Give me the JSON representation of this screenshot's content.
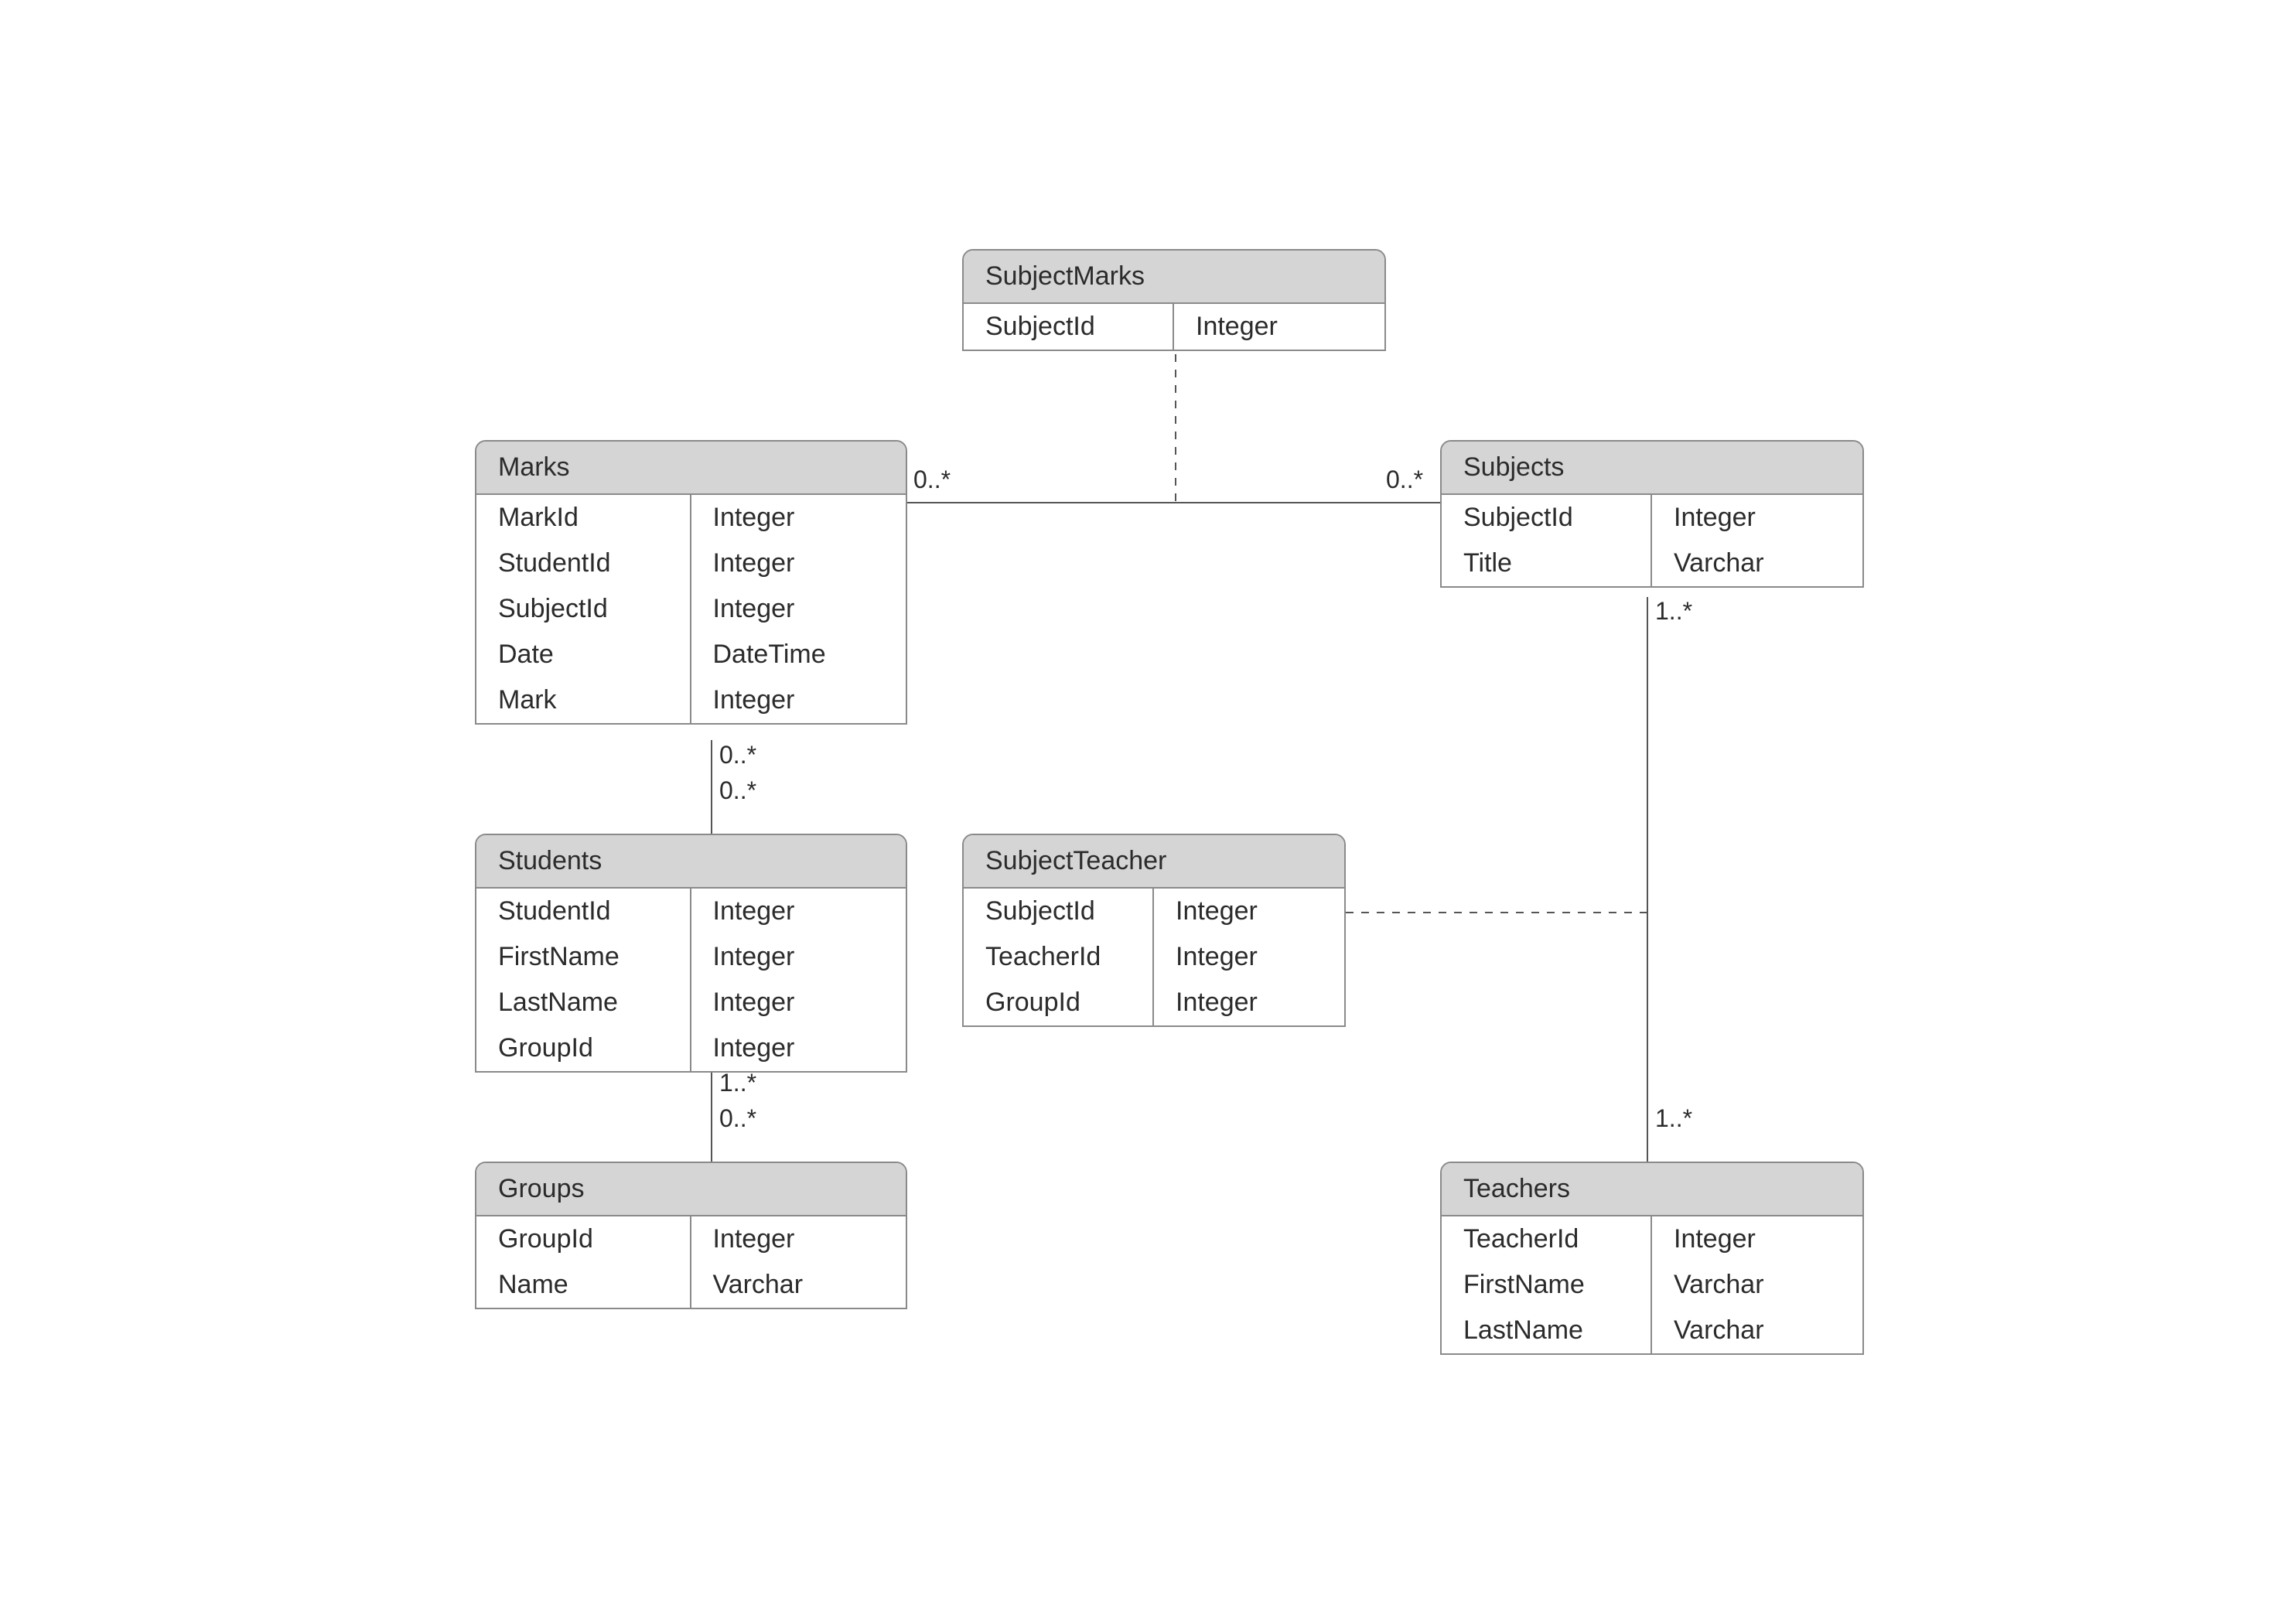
{
  "entities": {
    "subjectMarks": {
      "title": "SubjectMarks",
      "rows": [
        {
          "name": "SubjectId",
          "type": "Integer"
        }
      ]
    },
    "marks": {
      "title": "Marks",
      "rows": [
        {
          "name": "MarkId",
          "type": "Integer"
        },
        {
          "name": "StudentId",
          "type": "Integer"
        },
        {
          "name": "SubjectId",
          "type": "Integer"
        },
        {
          "name": "Date",
          "type": "DateTime"
        },
        {
          "name": "Mark",
          "type": "Integer"
        }
      ]
    },
    "subjects": {
      "title": "Subjects",
      "rows": [
        {
          "name": "SubjectId",
          "type": "Integer"
        },
        {
          "name": "Title",
          "type": "Varchar"
        }
      ]
    },
    "students": {
      "title": "Students",
      "rows": [
        {
          "name": "StudentId",
          "type": "Integer"
        },
        {
          "name": "FirstName",
          "type": "Integer"
        },
        {
          "name": "LastName",
          "type": "Integer"
        },
        {
          "name": "GroupId",
          "type": "Integer"
        }
      ]
    },
    "subjectTeacher": {
      "title": "SubjectTeacher",
      "rows": [
        {
          "name": "SubjectId",
          "type": "Integer"
        },
        {
          "name": "TeacherId",
          "type": "Integer"
        },
        {
          "name": "GroupId",
          "type": "Integer"
        }
      ]
    },
    "groups": {
      "title": "Groups",
      "rows": [
        {
          "name": "GroupId",
          "type": "Integer"
        },
        {
          "name": "Name",
          "type": "Varchar"
        }
      ]
    },
    "teachers": {
      "title": "Teachers",
      "rows": [
        {
          "name": "TeacherId",
          "type": "Integer"
        },
        {
          "name": "FirstName",
          "type": "Varchar"
        },
        {
          "name": "LastName",
          "type": "Varchar"
        }
      ]
    }
  },
  "multiplicities": {
    "marksToSubjects_left": "0..*",
    "marksToSubjects_right": "0..*",
    "subjects_bottom": "1..*",
    "marks_bottom": "0..*",
    "students_top": "0..*",
    "students_bottom": "1..*",
    "groups_top": "0..*",
    "teachers_top": "1..*"
  }
}
